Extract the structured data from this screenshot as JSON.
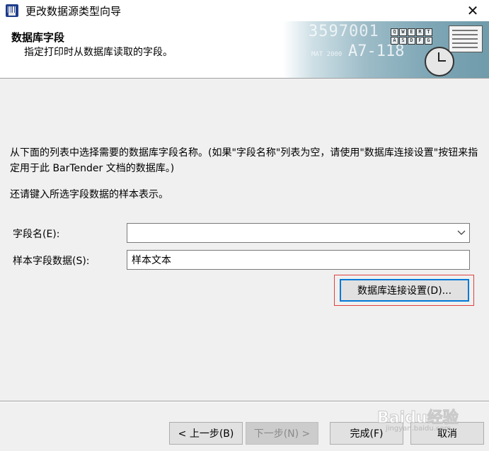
{
  "window": {
    "title": "更改数据源类型向导",
    "close_glyph": "✕"
  },
  "header": {
    "title": "数据库字段",
    "subtitle": "指定打印时从数据库读取的字段。",
    "banner_text_1": "3597001",
    "banner_text_2": "A7-118",
    "banner_text_3": "MAT 2000",
    "banner_keys": [
      "Q",
      "W",
      "E",
      "R",
      "T",
      "A",
      "S",
      "D",
      "F",
      "G"
    ]
  },
  "body": {
    "description": "从下面的列表中选择需要的数据库字段名称。(如果\"字段名称\"列表为空，请使用\"数据库连接设置\"按钮来指定用于此 BarTender 文档的数据库。)",
    "instruction": "还请键入所选字段数据的样本表示。",
    "field_name_label": "字段名(E):",
    "field_name_value": "",
    "sample_label": "样本字段数据(S):",
    "sample_value": "样本文本",
    "db_settings_button": "数据库连接设置(D)..."
  },
  "footer": {
    "prev_button": "< 上一步(B)",
    "next_button": "下一步(N) >",
    "finish_button": "完成(F)",
    "cancel_button": "取消"
  },
  "watermark": {
    "main": "Baidu经验",
    "sub": "jingyan.baidu.com"
  },
  "colors": {
    "accent": "#0078d7",
    "highlight_frame": "#e04040",
    "dialog_bg": "#f0f0f0"
  },
  "icons": {
    "app": "bartender-app-icon",
    "close": "close-icon",
    "dropdown": "chevron-down-icon"
  }
}
